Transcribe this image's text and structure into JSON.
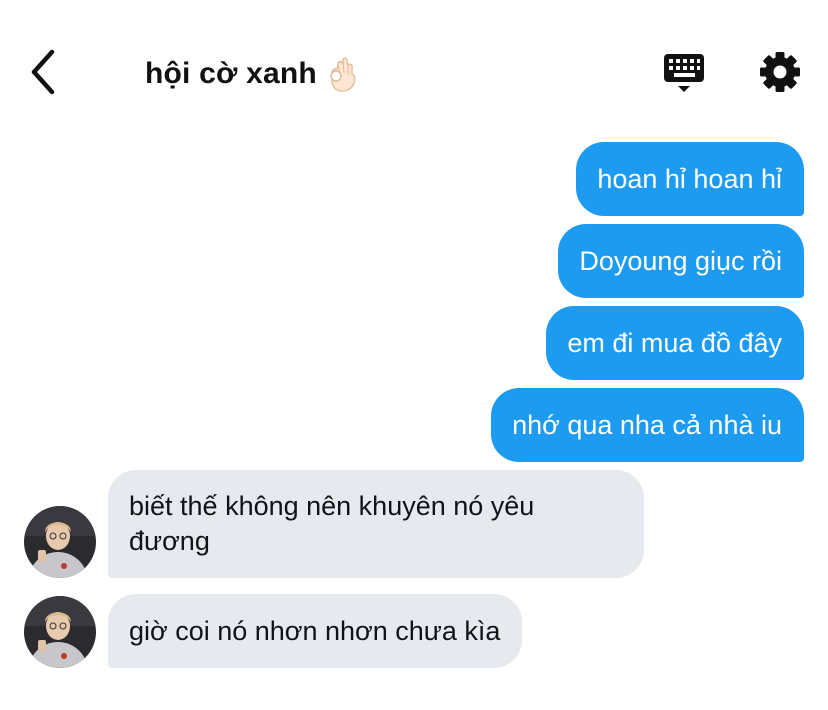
{
  "header": {
    "title": "hội cờ xanh",
    "emoji": "ok-hand-emoji",
    "icons": [
      "back-chevron-icon",
      "keyboard-icon",
      "gear-icon"
    ]
  },
  "messages": {
    "outgoing": [
      "hoan hỉ hoan hỉ",
      "Doyoung giục rồi",
      "em đi mua đồ đây",
      "nhớ qua nha cả nhà iu"
    ],
    "incoming": [
      "biết thế không nên khuyên nó yêu đương",
      "giờ coi nó nhơn nhơn chưa kìa"
    ]
  },
  "colors": {
    "outgoing_bubble": "#1d9bf0",
    "incoming_bubble": "#e6eaee",
    "text_dark": "#0f1419"
  }
}
